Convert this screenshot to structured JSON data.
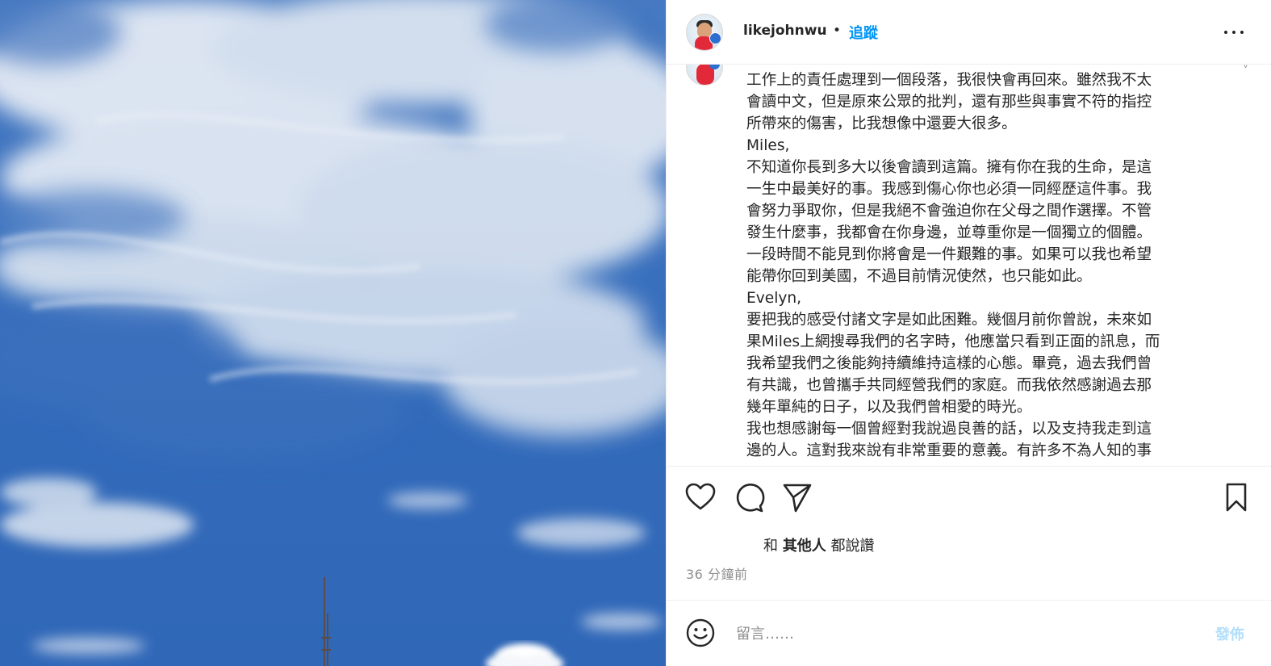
{
  "post": {
    "username": "likejohnwu",
    "separator": "•",
    "follow_label": "追蹤",
    "more_icon": "more-horizontal-icon"
  },
  "caption": {
    "lines": [
      "工作上的責任處理到一個段落，我很快會再回來。雖然我不太",
      "會讀中文，但是原來公眾的批判，還有那些與事實不符的指控",
      "所帶來的傷害，比我想像中還要大很多。",
      "Miles,",
      "不知道你長到多大以後會讀到這篇。擁有你在我的生命，是這",
      "一生中最美好的事。我感到傷心你也必須一同經歷這件事。我",
      "會努力爭取你，但是我絕不會強迫你在父母之間作選擇。不管",
      "發生什麼事，我都會在你身邊，並尊重你是一個獨立的個體。",
      "一段時間不能見到你將會是一件艱難的事。如果可以我也希望",
      "能帶你回到美國，不過目前情況使然，也只能如此。",
      "Evelyn,",
      "要把我的感受付諸文字是如此困難。幾個月前你曾說，未來如",
      "果Miles上網搜尋我們的名字時，他應當只看到正面的訊息，而",
      "我希望我們之後能夠持續維持這樣的心態。畢竟，過去我們曾",
      "有共識，也曾攜手共同經營我們的家庭。而我依然感謝過去那",
      "幾年單純的日子，以及我們曾相愛的時光。",
      "我也想感謝每一個曾經對我說過良善的話，以及支持我走到這",
      "邊的人。這對我來說有非常重要的意義。有許多不為人知的事"
    ]
  },
  "actions": {
    "like_icon": "heart-icon",
    "comment_icon": "comment-icon",
    "share_icon": "send-icon",
    "save_icon": "bookmark-icon"
  },
  "likes": {
    "prefix": "和",
    "others": "其他人",
    "suffix": "都說讚"
  },
  "timestamp": "36 分鐘前",
  "comment": {
    "emoji_icon": "emoji-icon",
    "placeholder": "留言……",
    "post_label": "發佈"
  },
  "colors": {
    "accent": "#0095f6",
    "post_disabled": "#b2dffc",
    "sky": "#3f74c0"
  }
}
